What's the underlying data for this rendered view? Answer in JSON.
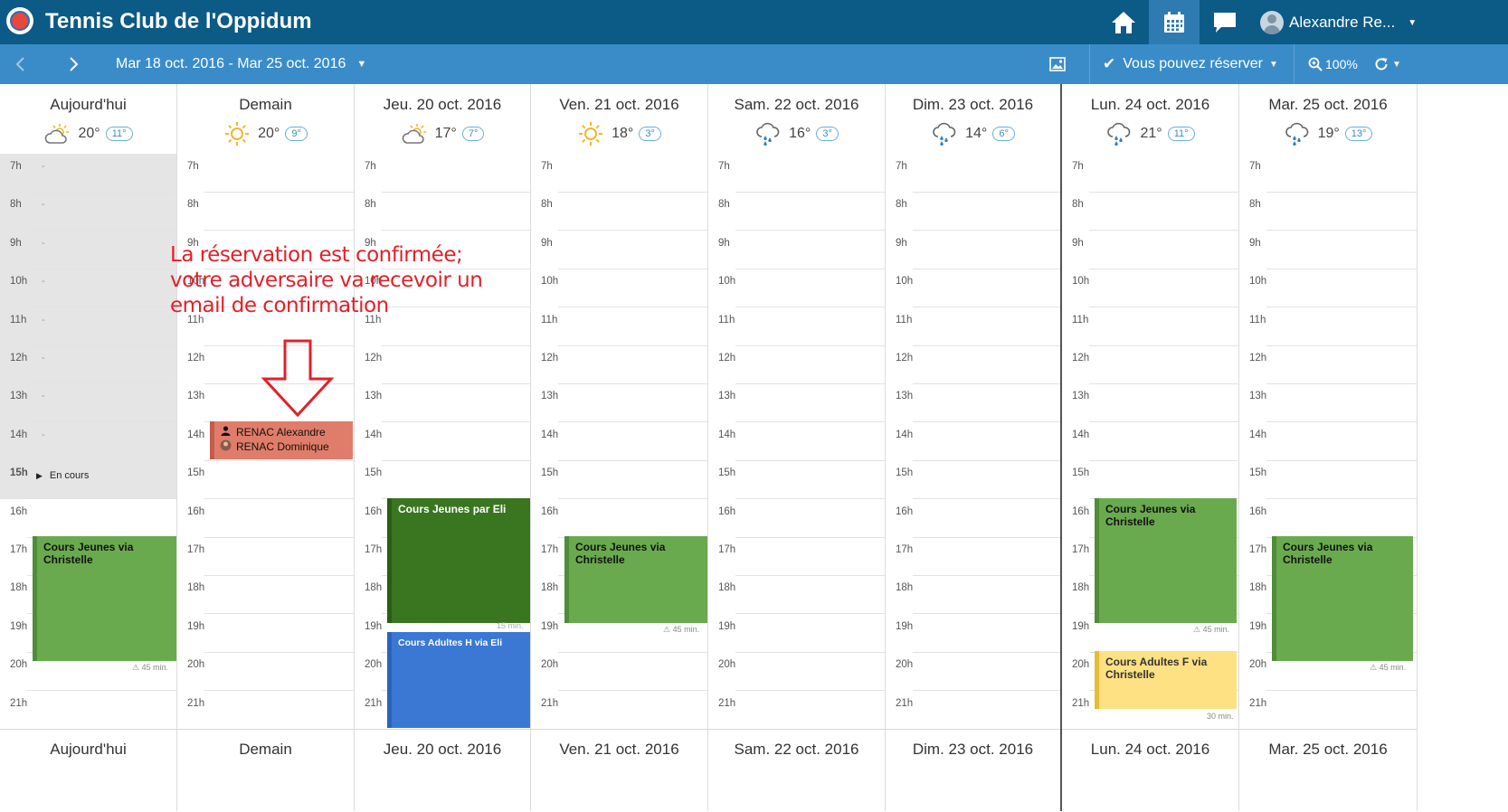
{
  "app": {
    "title": "Tennis Club de l'Oppidum",
    "user_name": "Alexandre Re...",
    "nav": [
      "home-icon",
      "calendar-icon",
      "chat-icon"
    ]
  },
  "toolbar": {
    "date_start": "Mar 18 oct. 2016",
    "date_separator": " - ",
    "date_end": "Mar 25 oct. 2016",
    "reserve_label": "Vous pouvez réserver",
    "zoom_label": "100%"
  },
  "hours": [
    "7h",
    "8h",
    "9h",
    "10h",
    "11h",
    "12h",
    "13h",
    "14h",
    "15h",
    "16h",
    "17h",
    "18h",
    "19h",
    "20h",
    "21h"
  ],
  "today_marker": "-",
  "en_cours_label": "En cours",
  "days": [
    {
      "name": "Aujourd'hui",
      "weather": "partly-cloudy-icon",
      "tmax": "20°",
      "tmin": "11°"
    },
    {
      "name": "Demain",
      "weather": "sun-icon",
      "tmax": "20°",
      "tmin": "9°"
    },
    {
      "name": "Jeu. 20 oct. 2016",
      "weather": "partly-cloudy-icon",
      "tmax": "17°",
      "tmin": "7°"
    },
    {
      "name": "Ven. 21 oct. 2016",
      "weather": "sun-icon",
      "tmax": "18°",
      "tmin": "3°"
    },
    {
      "name": "Sam. 22 oct. 2016",
      "weather": "rain-icon",
      "tmax": "16°",
      "tmin": "3°"
    },
    {
      "name": "Dim. 23 oct. 2016",
      "weather": "rain-icon",
      "tmax": "14°",
      "tmin": "6°"
    },
    {
      "name": "Lun. 24 oct. 2016",
      "weather": "rain-icon",
      "tmax": "21°",
      "tmin": "11°"
    },
    {
      "name": "Mar. 25 oct. 2016",
      "weather": "rain-icon",
      "tmax": "19°",
      "tmin": "13°"
    }
  ],
  "events": {
    "booking": {
      "player1": "RENAC Alexandre",
      "player2": "RENAC Dominique"
    },
    "today_course": {
      "title": "Cours Jeunes via Christelle",
      "duration": "45 min."
    },
    "thu_course": {
      "title": "Cours Jeunes par Eli",
      "duration": "15 min."
    },
    "thu_adults": {
      "title": "Cours Adultes H via Eli"
    },
    "fri_course": {
      "title": "Cours Jeunes via Christelle",
      "duration": "45 min."
    },
    "mon_course": {
      "title": "Cours Jeunes via Christelle",
      "duration": "45 min."
    },
    "mon_adults": {
      "title": "Cours Adultes F via Christelle",
      "duration": "30 min."
    },
    "tue_course": {
      "title": "Cours Jeunes via Christelle",
      "duration": "45 min."
    }
  },
  "annotation": {
    "line1": "La réservation est confirmée;",
    "line2": "votre adversaire va recevoir un",
    "line3": "email de confirmation"
  },
  "colors": {
    "topbar": "#0c5a86",
    "toolbar": "#3a8cc9",
    "course_green": "#6aaa4e",
    "course_dark_green": "#39761f",
    "course_blue": "#3b78d4",
    "course_yellow": "#fde182",
    "booking_red": "#e07d6a",
    "annotation_red": "#e2202a"
  }
}
